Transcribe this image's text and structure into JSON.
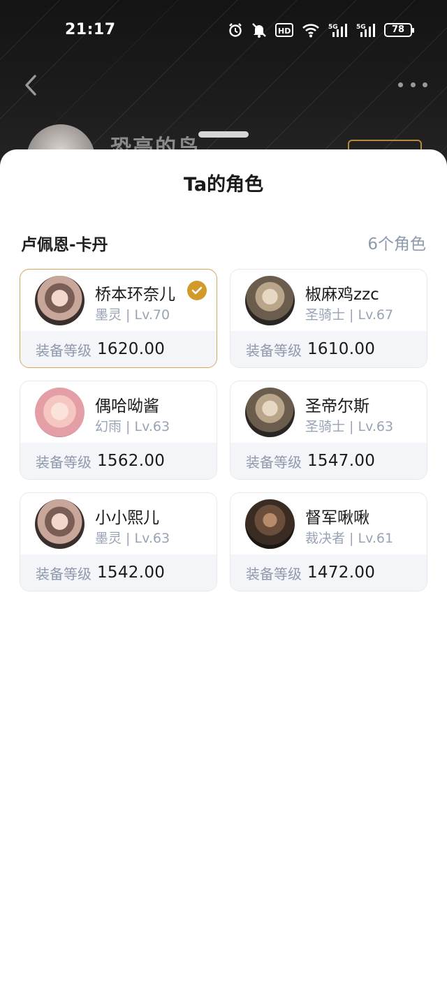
{
  "status_bar": {
    "time": "21:17",
    "battery": "78"
  },
  "profile": {
    "name": "恐高的鸟"
  },
  "sheet": {
    "title": "Ta的角色",
    "server": "卢佩恩-卡丹",
    "role_count": "6个角色",
    "gear_label": "装备等级",
    "characters": [
      {
        "name": "桥本环奈儿",
        "info": "墨灵 | Lv.70",
        "gear": "1620.00",
        "selected": true,
        "avatar": "doll-girl-avatar"
      },
      {
        "name": "椒麻鸡zzc",
        "info": "圣骑士 | Lv.67",
        "gear": "1610.00",
        "selected": false,
        "avatar": "blonde-knight-avatar"
      },
      {
        "name": "偶哈呦酱",
        "info": "幻雨 | Lv.63",
        "gear": "1562.00",
        "selected": false,
        "avatar": "fox-girl-avatar"
      },
      {
        "name": "圣帝尔斯",
        "info": "圣骑士 | Lv.63",
        "gear": "1547.00",
        "selected": false,
        "avatar": "blonde-knight-avatar"
      },
      {
        "name": "小小熙儿",
        "info": "墨灵 | Lv.63",
        "gear": "1542.00",
        "selected": false,
        "avatar": "doll-girl-avatar"
      },
      {
        "name": "督军啾啾",
        "info": "裁决者 | Lv.61",
        "gear": "1472.00",
        "selected": false,
        "avatar": "dark-warrior-avatar"
      }
    ]
  }
}
